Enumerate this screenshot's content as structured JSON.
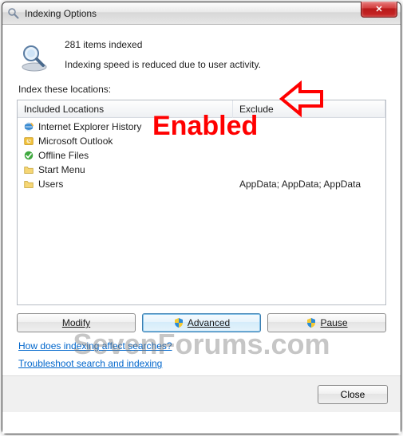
{
  "window": {
    "title": "Indexing Options",
    "close_glyph": "✕"
  },
  "info": {
    "count_text": "281 items indexed",
    "status_text": "Indexing speed is reduced due to user activity."
  },
  "locations_label": "Index these locations:",
  "columns": {
    "included": "Included Locations",
    "exclude": "Exclude"
  },
  "rows": [
    {
      "icon": "ie",
      "name": "Internet Explorer History",
      "exclude": ""
    },
    {
      "icon": "outlook",
      "name": "Microsoft Outlook",
      "exclude": ""
    },
    {
      "icon": "offline",
      "name": "Offline Files",
      "exclude": ""
    },
    {
      "icon": "folder",
      "name": "Start Menu",
      "exclude": ""
    },
    {
      "icon": "folder",
      "name": "Users",
      "exclude": "AppData; AppData; AppData"
    }
  ],
  "buttons": {
    "modify": "Modify",
    "advanced": "Advanced",
    "pause": "Pause",
    "close": "Close"
  },
  "links": {
    "how": "How does indexing affect searches?",
    "troubleshoot": "Troubleshoot search and indexing"
  },
  "annotation": {
    "enabled": "Enabled",
    "watermark": "SevenForums.com"
  }
}
